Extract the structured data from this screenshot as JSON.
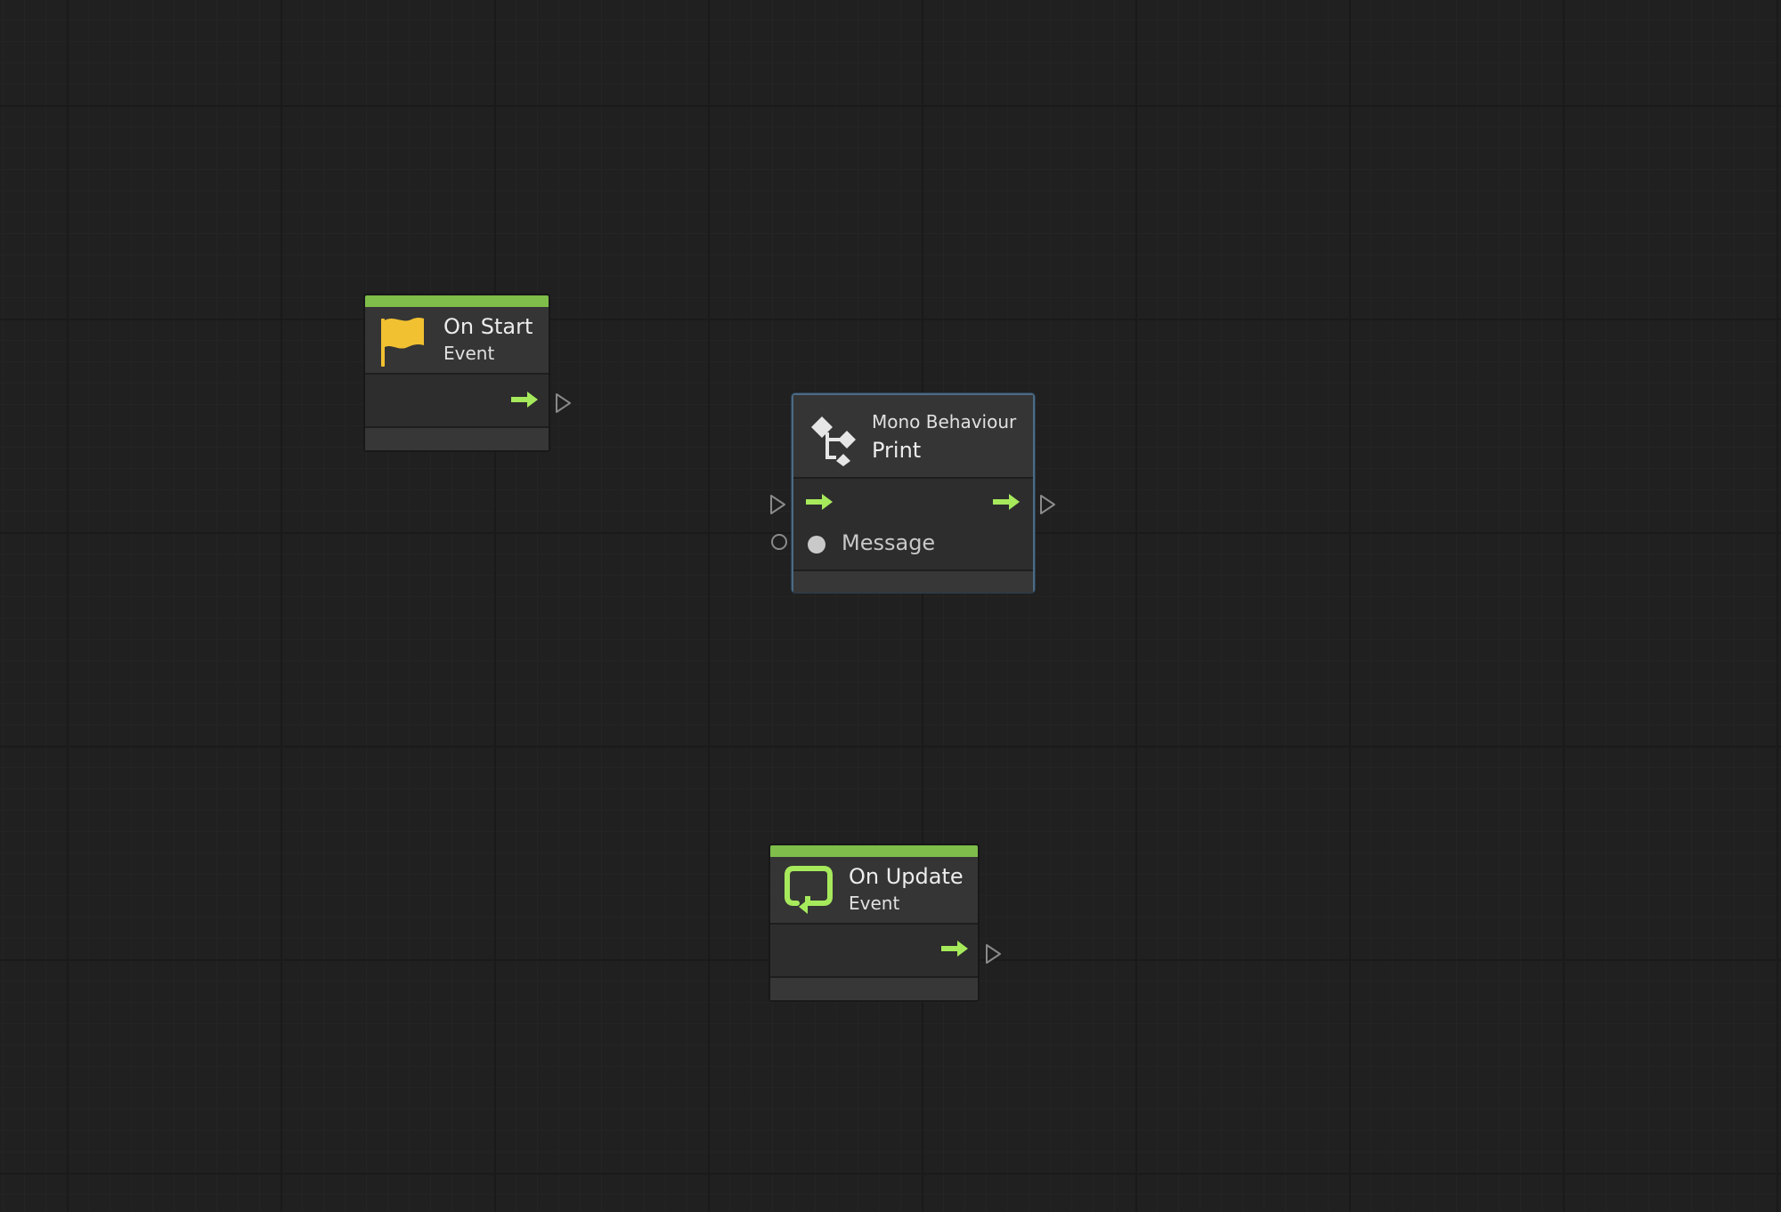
{
  "graph": {
    "nodes": [
      {
        "id": "on-start",
        "title": "On Start",
        "subtitle": "Event",
        "icon": "flag-icon",
        "icon_color": "#f2c131",
        "accent": "#7fbe4a"
      },
      {
        "id": "print",
        "category": "Mono Behaviour",
        "title": "Print",
        "icon": "flow-graph-icon",
        "selected": true,
        "ports": {
          "value_input_label": "Message"
        }
      },
      {
        "id": "on-update",
        "title": "On Update",
        "subtitle": "Event",
        "icon": "loop-icon",
        "icon_color": "#a6ea5c",
        "accent": "#7fbe4a"
      }
    ]
  },
  "colors": {
    "canvas_bg": "#202020",
    "flow_arrow": "#a6ea5c",
    "event_header": "#7fbe4a",
    "selection_border": "#4c6b85",
    "port_outline": "#8a8a8a"
  }
}
